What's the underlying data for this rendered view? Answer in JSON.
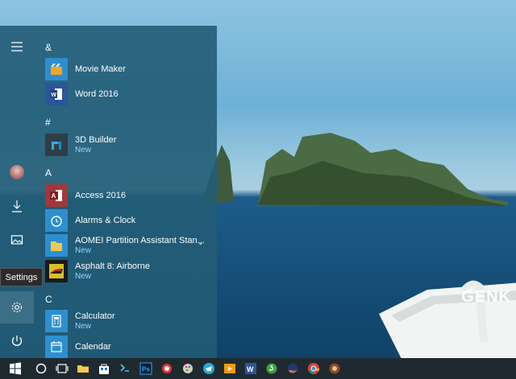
{
  "start_menu": {
    "rail": {
      "tooltip": "Settings"
    },
    "groups": [
      {
        "letter": "&",
        "apps": [
          {
            "name": "Movie Maker",
            "badge": "",
            "tile_color": "#2d8fd0",
            "icon": "movie-maker-icon"
          },
          {
            "name": "Word 2016",
            "badge": "",
            "tile_color": "#2a5699",
            "icon": "word-icon"
          }
        ]
      },
      {
        "letter": "#",
        "apps": [
          {
            "name": "3D Builder",
            "badge": "New",
            "tile_color": "#2f3e46",
            "icon": "3d-builder-icon"
          }
        ]
      },
      {
        "letter": "A",
        "apps": [
          {
            "name": "Access 2016",
            "badge": "",
            "tile_color": "#a4373a",
            "icon": "access-icon"
          },
          {
            "name": "Alarms & Clock",
            "badge": "",
            "tile_color": "#2d8fd0",
            "icon": "alarm-clock-icon"
          },
          {
            "name": "AOMEI Partition Assistant Stan...",
            "badge": "New",
            "tile_color": "#e8c22e",
            "icon": "folder-icon"
          },
          {
            "name": "Asphalt 8: Airborne",
            "badge": "New",
            "tile_color": "#1a1a1a",
            "icon": "asphalt-icon"
          }
        ]
      },
      {
        "letter": "C",
        "apps": [
          {
            "name": "Calculator",
            "badge": "New",
            "tile_color": "#2d8fd0",
            "icon": "calculator-icon"
          },
          {
            "name": "Calendar",
            "badge": "",
            "tile_color": "#2d8fd0",
            "icon": "calendar-icon"
          }
        ]
      }
    ]
  },
  "taskbar": {
    "items": [
      "windows-logo-icon",
      "cortana-icon",
      "task-view-icon",
      "file-explorer-icon",
      "store-icon",
      "network-tool-icon",
      "photoshop-icon",
      "chrome-like-icon",
      "paint-icon",
      "telegram-icon",
      "media-player-icon",
      "word-icon",
      "skype-icon",
      "firefox-icon",
      "chrome-icon",
      "game-icon"
    ]
  },
  "watermark": "GENK",
  "colors": {
    "accent_new": "#8fd8ff",
    "start_bg": "#225c76",
    "taskbar_bg": "#1f2a30"
  }
}
